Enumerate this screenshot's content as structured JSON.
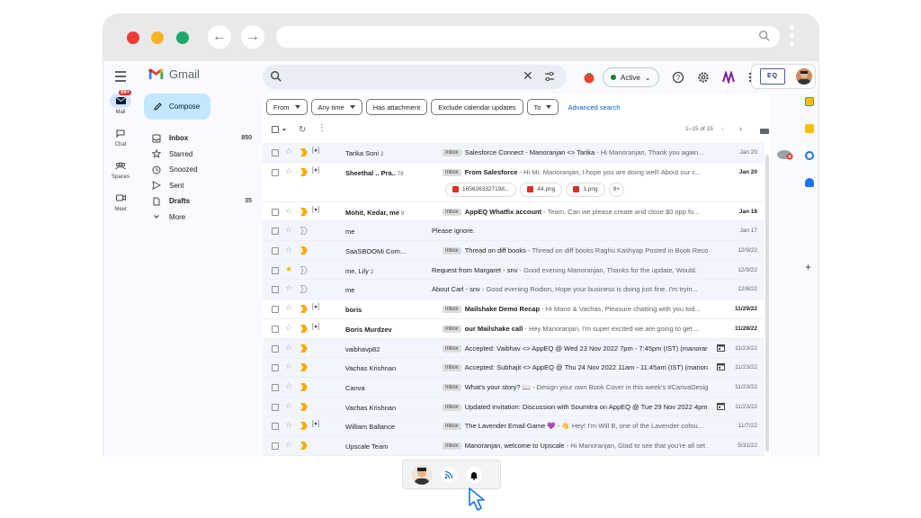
{
  "app": {
    "brand": "Gmail"
  },
  "header": {
    "status": "Active",
    "org_badge": "EQ",
    "org_small": "APP"
  },
  "rail": [
    {
      "label": "Mail",
      "badge": "99+"
    },
    {
      "label": "Chat"
    },
    {
      "label": "Spaces"
    },
    {
      "label": "Meet"
    }
  ],
  "nav": {
    "compose": "Compose",
    "items": [
      {
        "label": "Inbox",
        "count": "850",
        "icon": "inbox-icon"
      },
      {
        "label": "Starred",
        "count": "",
        "icon": "star-icon"
      },
      {
        "label": "Snoozed",
        "count": "",
        "icon": "clock-icon"
      },
      {
        "label": "Sent",
        "count": "",
        "icon": "send-icon"
      },
      {
        "label": "Drafts",
        "count": "35",
        "icon": "draft-icon"
      },
      {
        "label": "More",
        "count": "",
        "icon": "chevron-down-icon"
      }
    ]
  },
  "filters": {
    "from": "From",
    "any_time": "Any time",
    "has_attachment": "Has attachment",
    "exclude_calendar": "Exclude calendar updates",
    "to": "To",
    "advanced": "Advanced search"
  },
  "toolbar": {
    "pager": "1–15 of 15"
  },
  "emails": [
    {
      "sender": "Tarika Soni",
      "n": "2",
      "tag": "Inbox",
      "subject": "Salesforce Connect - Manoranjan <> Tarika",
      "snippet": " - Hi Manoranjan, Thank you again...",
      "date": "Jan 20",
      "unread": false,
      "starred": false,
      "group": true
    },
    {
      "sender": "Sheethal .. Pra..",
      "n": "78",
      "tag": "Inbox",
      "subject": "From Salesforce",
      "snippet": " - Hi Mr. Manoranjan, I hope you are doing well! About our c...",
      "date": "Jan 20",
      "unread": true,
      "starred": false,
      "group": true,
      "attachments": [
        "1656263327198...",
        "44.png",
        "1.png",
        "9+"
      ]
    },
    {
      "sender": "Mohit, Kedar, me",
      "n": "9",
      "tag": "Inbox",
      "subject": "AppEQ Whatfix account",
      "snippet": " - Team, Can we please create and close $0 opp fo...",
      "date": "Jan 18",
      "unread": true,
      "starred": false,
      "group": true
    },
    {
      "sender": "me",
      "n": "",
      "tag": "",
      "subject": "Please ignore.",
      "snippet": "",
      "date": "Jan 17",
      "unread": false,
      "starred": false,
      "group": false
    },
    {
      "sender": "SaaSBOOMi Com...",
      "n": "",
      "tag": "Inbox",
      "subject": "Thread on diff books",
      "snippet": " - Thread on diff books Raghu Kashyap Posted in Book Reco...",
      "date": "12/9/22",
      "unread": false,
      "starred": false,
      "group": false
    },
    {
      "sender": "me, Lily",
      "n": "2",
      "tag": "",
      "subject": "Request from Margaret - snv",
      "snippet": " - Good evening Manoranjan, Thanks for the update, Would...",
      "date": "12/9/22",
      "unread": false,
      "starred": true,
      "group": false
    },
    {
      "sender": "me",
      "n": "",
      "tag": "",
      "subject": "About Carl - snv",
      "snippet": " - Good evening Rodion, Hope your business is doing just fine. I'm tryin...",
      "date": "12/8/22",
      "unread": false,
      "starred": false,
      "group": false
    },
    {
      "sender": "boris",
      "n": "",
      "tag": "Inbox",
      "subject": "Mailshake Demo Recap",
      "snippet": " - Hi Mano & Vachas, Pleasure chatting with you tod...",
      "date": "11/29/22",
      "unread": true,
      "starred": false,
      "group": true
    },
    {
      "sender": "Boris Murdzev",
      "n": "",
      "tag": "Inbox",
      "subject": "our Mailshake call",
      "snippet": " - Hey Manoranjan, I'm super excited we are going to get ...",
      "date": "11/28/22",
      "unread": true,
      "starred": false,
      "group": true
    },
    {
      "sender": "vaibhavp82",
      "n": "",
      "tag": "Inbox",
      "subject": "Accepted: Vaibhav <> AppEQ @ Wed 23 Nov 2022 7pm - 7:45pm (IST) (manoranj...",
      "snippet": "",
      "date": "11/23/22",
      "unread": false,
      "starred": false,
      "group": false,
      "cal": true
    },
    {
      "sender": "Vachas Krishnan",
      "n": "",
      "tag": "Inbox",
      "subject": "Accepted: Subhajit <> AppEQ @ Thu 24 Nov 2022 11am - 11:45am (IST) (manoranj...",
      "snippet": "",
      "date": "11/23/22",
      "unread": false,
      "starred": false,
      "group": false,
      "cal": true
    },
    {
      "sender": "Canva",
      "n": "",
      "tag": "Inbox",
      "subject": "What's your story? 📖",
      "snippet": " - Design your own Book Cover in this week's #CanvaDesig...",
      "date": "11/23/22",
      "unread": false,
      "starred": false,
      "group": false
    },
    {
      "sender": "Vachas Krishnan",
      "n": "",
      "tag": "Inbox",
      "subject": "Updated invitation: Discussion with Soumitra on AppEQ @ Tue 29 Nov 2022 4pm ...",
      "snippet": "",
      "date": "11/23/22",
      "unread": false,
      "starred": false,
      "group": false,
      "cal": true
    },
    {
      "sender": "William Ballance",
      "n": "",
      "tag": "Inbox",
      "subject": "The Lavender Email Game 💜",
      "snippet": " - 👋 Hey! I'm Will B, one of the Lavender cofou...",
      "date": "11/7/22",
      "unread": false,
      "starred": false,
      "group": true
    },
    {
      "sender": "Upscale Team",
      "n": "",
      "tag": "Inbox",
      "subject": "Manoranjan, welcome to Upscale",
      "snippet": " - Hi Manoranjan, Glad to see that you're all set ...",
      "date": "5/31/22",
      "unread": false,
      "starred": false,
      "group": false
    }
  ],
  "colors": {
    "accent": "#0b57d0",
    "compose": "#c2e7ff",
    "badge": "#d93025",
    "star": "#f4b400",
    "important": "#f9ab00"
  }
}
